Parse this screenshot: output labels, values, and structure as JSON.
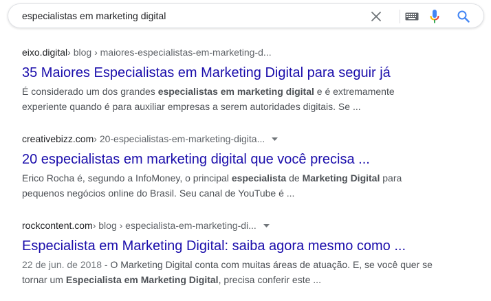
{
  "search": {
    "query": "especialistas em marketing digital"
  },
  "icons": {
    "clear": "close-icon",
    "keyboard": "keyboard-icon",
    "voice": "microphone-icon",
    "search": "search-icon"
  },
  "colors": {
    "link": "#1a0dab",
    "snippet": "#4d5156",
    "mic_blue": "#4285f4",
    "mic_red": "#ea4335",
    "mic_yellow": "#fbbc05",
    "mic_green": "#34a853"
  },
  "results": [
    {
      "domain": "eixo.digital",
      "path": " › blog › maiores-especialistas-em-marketing-d...",
      "has_menu": false,
      "title": "35 Maiores Especialistas em Marketing Digital para seguir já",
      "line1_a": "É considerado um dos grandes ",
      "line1_b": "especialistas em marketing digital",
      "line1_c": " e é extremamente",
      "line2": "experiente quando é para auxiliar empresas a serem autoridades digitais. Se ..."
    },
    {
      "domain": "creativebizz.com",
      "path": " › 20-especialistas-em-marketing-digita...",
      "has_menu": true,
      "title": "20 especialistas em marketing digital que você precisa ...",
      "line1_a": "Erico Rocha é, segundo a InfoMoney, o principal ",
      "line1_b": "especialista",
      "line1_c": " de ",
      "line1_d": "Marketing Digital",
      "line1_e": " para",
      "line2": "pequenos negócios online do Brasil. Seu canal de YouTube é ..."
    },
    {
      "domain": "rockcontent.com",
      "path": " › blog › especialista-em-marketing-di...",
      "has_menu": true,
      "title": "Especialista em Marketing Digital: saiba agora mesmo como ...",
      "date": "22 de jun. de 2018 - ",
      "line1_a": "O Marketing Digital conta com muitas áreas de atuação. E, se você quer se",
      "line2_a": "tornar um ",
      "line2_b": "Especialista em Marketing Digital",
      "line2_c": ", precisa conferir este ..."
    }
  ]
}
